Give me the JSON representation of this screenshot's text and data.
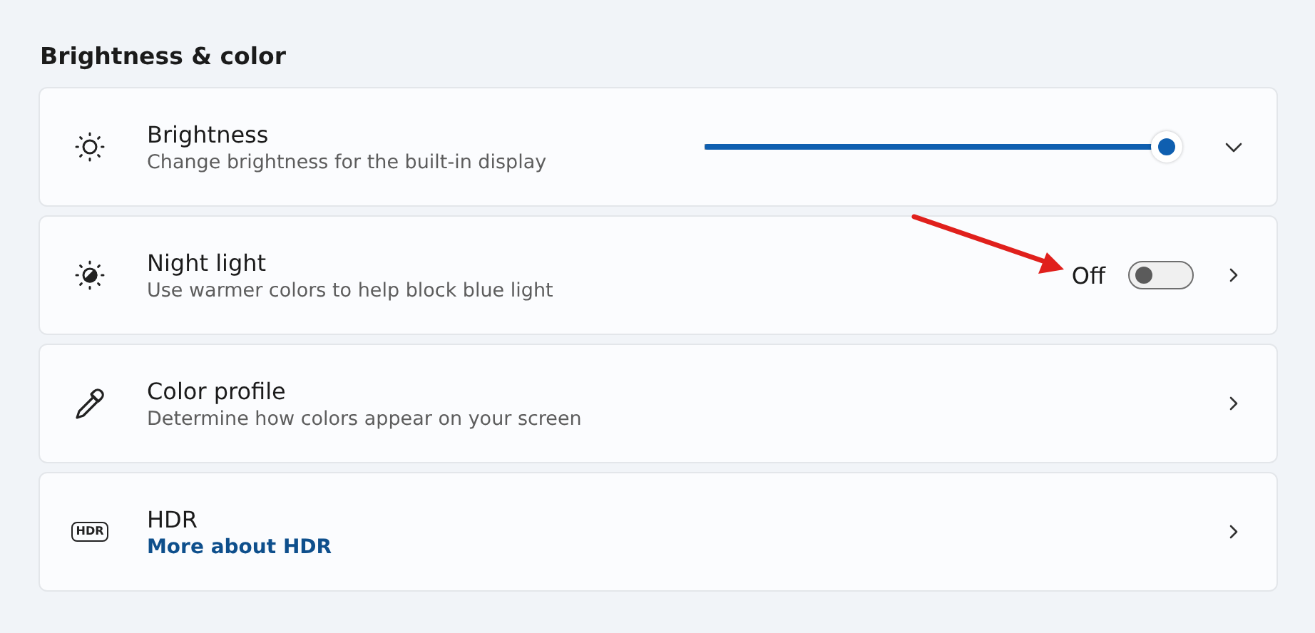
{
  "section_title": "Brightness & color",
  "rows": [
    {
      "kind": "slider",
      "title": "Brightness",
      "subtitle": "Change brightness for the built-in display",
      "level": 1.0,
      "expanded": false
    },
    {
      "kind": "toggle",
      "title": "Night light",
      "subtitle": "Use warmer colors to help block blue light",
      "state_label": "Off",
      "on": false
    },
    {
      "kind": "nav",
      "title": "Color profile",
      "subtitle": "Determine how colors appear on your screen"
    },
    {
      "kind": "nav",
      "title": "HDR",
      "icon_label": "HDR",
      "link": "More about HDR"
    }
  ],
  "annotation": {
    "kind": "arrow",
    "color": "#e0201c"
  }
}
